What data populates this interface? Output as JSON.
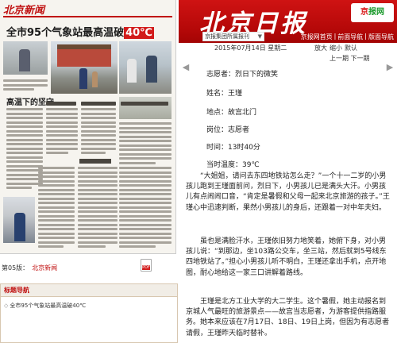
{
  "header": {
    "masthead": "北京日报",
    "logo": {
      "part1": "京",
      "part2": "报网",
      "icon": "beijing-daily-logo"
    },
    "site_select": "京报集团所属报刊",
    "nav_links": [
      "京报网首页",
      "|",
      "前面导航",
      "|",
      "版面导航"
    ]
  },
  "toolbar": {
    "date": "2015年07月14日  星期二",
    "actions": [
      "放大",
      "缩小",
      "默认"
    ],
    "pager": [
      "上一期",
      "下一期"
    ]
  },
  "paper": {
    "masthead": "北京新闻",
    "headline": "全市95个气象站最高温破",
    "headline_temp": "40℃",
    "section_heading": "高温下的坚守"
  },
  "meta": {
    "label": "第05版：",
    "value": "北京新闻"
  },
  "title_nav": {
    "title": "标题导航",
    "items": [
      "全市95个气象站最高温破40℃"
    ]
  },
  "article": {
    "fields": [
      "志愿者：烈日下的微笑",
      "姓名：王瑾",
      "地点：故宫北门",
      "岗位：志愿者",
      "时间：13时40分",
      "当时温度：39℃"
    ],
    "paragraphs": [
      "“大姐姐，请问去东四地铁站怎么走？”一个十一二岁的小男孩儿跑到王瑾面前问，烈日下，小男孩儿已是满头大汗。小男孩儿有点闹闹口音，“肯定是暑假和父母一起来北京旅游的孩子。”王瑾心中迅速判断，果然小男孩儿的身后，还跟着一对中年夫妇。",
      "虽也是满脸汗水，王瑾依旧努力地笑着，她俯下身，对小男孩儿说：“到那边，坐103路公交车，坐三站，然后就到5号线东四地铁站了。”担心小男孩儿听不明白，王瑾还拿出手机，点开地图，耐心地给这一家三口讲解着路线。",
      "王瑾是北方工业大学的大二学生。这个暑假，她主动报名到京城人气最旺的旅游景点——故宫当志愿者，为游客提供指路服务。她本来应该在7月17日、18日、19日上岗，但因为有志愿者请假，王瑾昨天临时替补。"
    ]
  }
}
